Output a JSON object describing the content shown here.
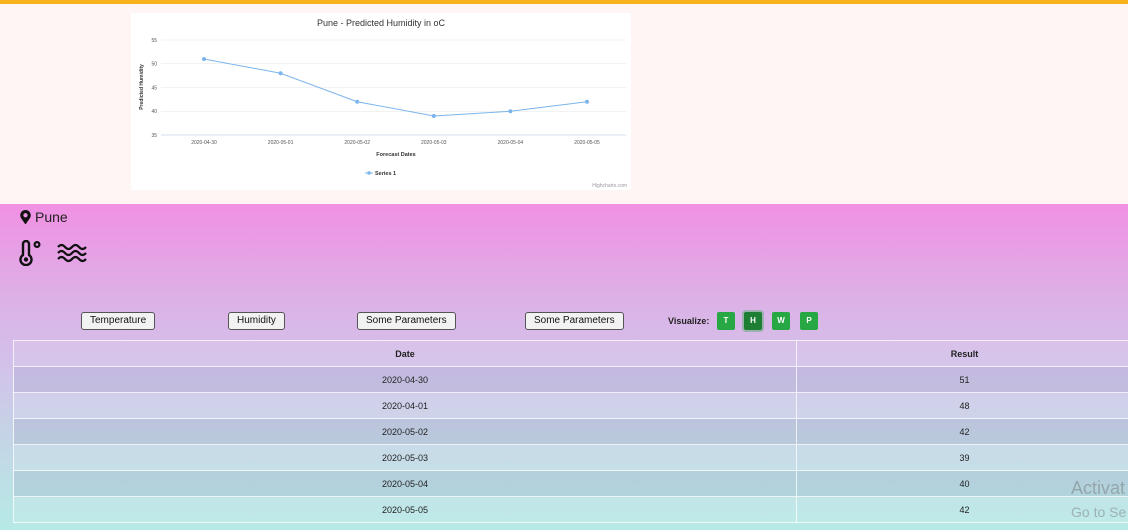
{
  "chart_data": {
    "type": "line",
    "title": "Pune - Predicted Humidity in oC",
    "xlabel": "Forecast Dates",
    "ylabel": "Predicted Humidity",
    "categories": [
      "2020-04-30",
      "2020-05-01",
      "2020-05-02",
      "2020-05-03",
      "2020-05-04",
      "2020-05-05"
    ],
    "series": [
      {
        "name": "Series 1",
        "values": [
          51,
          48,
          42,
          39,
          40,
          42
        ],
        "color": "#7cb5ec"
      }
    ],
    "ylim": [
      35,
      55
    ],
    "yticks": [
      "35",
      "40",
      "45",
      "50",
      "55"
    ],
    "grid": true,
    "legend": "bottom-center",
    "credit": "Highcharts.com"
  },
  "location": {
    "city": "Pune"
  },
  "icons": {
    "location": "map-marker-icon",
    "temperature": "thermometer-icon",
    "humidity": "water-waves-icon"
  },
  "parameter_buttons": [
    "Temperature",
    "Humidity",
    "Some Parameters",
    "Some Parameters"
  ],
  "visualize": {
    "label": "Visualize:",
    "buttons": [
      {
        "label": "T",
        "active": false
      },
      {
        "label": "H",
        "active": true
      },
      {
        "label": "W",
        "active": false
      },
      {
        "label": "P",
        "active": false
      }
    ]
  },
  "table": {
    "headers": [
      "Date",
      "Result"
    ],
    "rows": [
      [
        "2020-04-30",
        "51"
      ],
      [
        "2020-04-01",
        "48"
      ],
      [
        "2020-05-02",
        "42"
      ],
      [
        "2020-05-03",
        "39"
      ],
      [
        "2020-05-04",
        "40"
      ],
      [
        "2020-05-05",
        "42"
      ]
    ]
  },
  "watermark": {
    "line1": "Activat",
    "line2": "Go to Se"
  },
  "colors": {
    "accent_bar": "#f5b21a",
    "button_green": "#28a745",
    "series": "#7cb5ec"
  }
}
